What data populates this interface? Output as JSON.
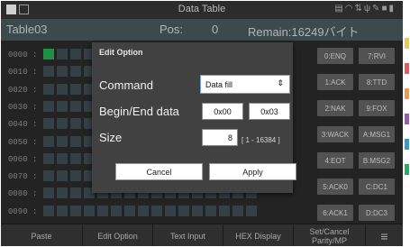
{
  "status_bar": {
    "title": "Data Table",
    "icons": [
      "sd-card-icon",
      "wifi-icon",
      "sync-icon",
      "usb-icon",
      "tool-icon",
      "save-icon",
      "battery-icon"
    ]
  },
  "info_bar": {
    "table_name": "Table03",
    "pos_label": "Pos:",
    "pos_value": "0",
    "remain": "Remain:16249バイト"
  },
  "grid": {
    "row_labels": [
      "0000 :",
      "0010 :",
      "0020 :",
      "0030 :",
      "0040 :",
      "0050 :",
      "0060 :",
      "0070 :",
      "0080 :",
      "0090 :"
    ],
    "selected_cell": "0000:0"
  },
  "char_buttons": [
    [
      "0:ENQ",
      "7:RVI"
    ],
    [
      "1:ACK",
      "8:TTD"
    ],
    [
      "2:NAK",
      "9:FOX"
    ],
    [
      "3:WACK",
      "A:MSG1"
    ],
    [
      "4:EOT",
      "B:MSG2"
    ],
    [
      "5:ACK0",
      "C:DC1"
    ],
    [
      "6:ACK1",
      "D:DC3"
    ]
  ],
  "bottom_bar": {
    "buttons": [
      "Paste",
      "Edit Option",
      "Text Input",
      "HEX Display",
      "Set/Cancel Parity/MP"
    ],
    "menu_icon": "menu-icon"
  },
  "dialog": {
    "title": "Edit Option",
    "command_label": "Command",
    "command_value": "Data fill",
    "begin_end_label": "Begin/End data",
    "begin_value": "0x00",
    "end_value": "0x03",
    "size_label": "Size",
    "size_value": "8",
    "size_range": "[ 1 - 16384 ]",
    "cancel_label": "Cancel",
    "apply_label": "Apply"
  },
  "colors": {
    "screen_bg": "#232323",
    "info_bar_bg": "#3c4a4e",
    "cell_bg": "#344046",
    "cell_selected": "#1f8f46",
    "dialog_bg": "#414141",
    "select_border": "#6a9fe0"
  }
}
